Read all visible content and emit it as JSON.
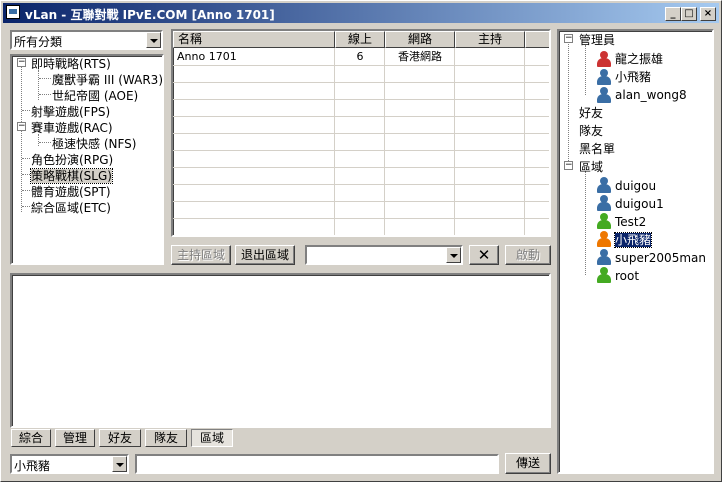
{
  "window": {
    "title": "vLan - 互聯對戰 IPvE.COM [Anno 1701]"
  },
  "titlebar_buttons": {
    "minimize": "_",
    "maximize": "□",
    "close": "×"
  },
  "category_select": {
    "value": "所有分類"
  },
  "categories": [
    {
      "label": "即時戰略(RTS)",
      "expanded": true,
      "children": [
        "魔獸爭霸 III (WAR3)",
        "世紀帝國 (AOE)"
      ]
    },
    {
      "label": "射擊遊戲(FPS)"
    },
    {
      "label": "賽車遊戲(RAC)",
      "expanded": true,
      "children": [
        "極速快感 (NFS)"
      ]
    },
    {
      "label": "角色扮演(RPG)"
    },
    {
      "label": "策略戰棋(SLG)",
      "selected": true
    },
    {
      "label": "體育遊戲(SPT)"
    },
    {
      "label": "綜合區域(ETC)"
    }
  ],
  "room_table": {
    "headers": [
      "名稱",
      "線上",
      "網路",
      "主持"
    ],
    "rows": [
      {
        "name": "Anno 1701",
        "online": "6",
        "network": "香港網路",
        "host": ""
      }
    ]
  },
  "room_actions": {
    "host_label": "主持區域",
    "leave_label": "退出區域",
    "game_select_value": "",
    "remove_label": "✕",
    "launch_label": "啟動"
  },
  "bottom_tabs": [
    "綜合",
    "管理",
    "好友",
    "隊友",
    "區域"
  ],
  "active_tab": "區域",
  "chat_input": {
    "user_select": "小飛豬",
    "message": "",
    "send_label": "傳送"
  },
  "user_tree": {
    "admins_label": "管理員",
    "admins": [
      {
        "name": "龍之振雄",
        "color": "#cc3333"
      },
      {
        "name": "小飛豬",
        "color": "#3a6ea5"
      },
      {
        "name": "alan_wong8",
        "color": "#3a6ea5"
      }
    ],
    "friends_label": "好友",
    "team_label": "隊友",
    "blacklist_label": "黑名單",
    "zone_label": "區域",
    "zone_users": [
      {
        "name": "duigou",
        "color": "#3a6ea5"
      },
      {
        "name": "duigou1",
        "color": "#3a6ea5"
      },
      {
        "name": "Test2",
        "color": "#44aa22"
      },
      {
        "name": "小飛豬",
        "color": "#ee7700",
        "selected": true
      },
      {
        "name": "super2005man",
        "color": "#3a6ea5"
      },
      {
        "name": "root",
        "color": "#44aa22"
      }
    ]
  },
  "colors": {
    "titlebar_start": "#0a246a",
    "titlebar_end": "#a6caf0",
    "face": "#d4d0c8",
    "selection": "#0a246a"
  }
}
